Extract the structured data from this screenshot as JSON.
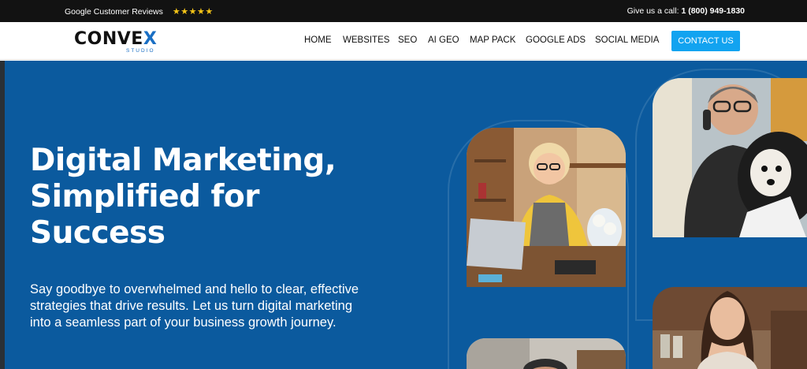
{
  "topbar": {
    "reviews_label": "Google Customer Reviews",
    "stars": "★★★★★",
    "call_prefix": "Give us a call:",
    "phone": "1 (800) 949-1830"
  },
  "brand": {
    "name_main": "CONVE",
    "name_x": "X",
    "tagline": "STUDIO"
  },
  "nav": {
    "items": [
      "HOME",
      "WEBSITES",
      "SEO",
      "AI GEO",
      "MAP PACK",
      "GOOGLE ADS",
      "SOCIAL MEDIA"
    ],
    "cta": "CONTACT US"
  },
  "hero": {
    "headline": "Digital Marketing, Simplified for Success",
    "subtext": "Say goodbye to overwhelmed and hello to clear, effective strategies that drive results. Let us turn digital marketing into a seamless part of your business growth journey."
  },
  "colors": {
    "hero_bg": "#0b5a9e",
    "cta_bg": "#12a3f0",
    "stars": "#f5c518",
    "topbar_bg": "#121212"
  },
  "icons": [
    "star-icon"
  ]
}
